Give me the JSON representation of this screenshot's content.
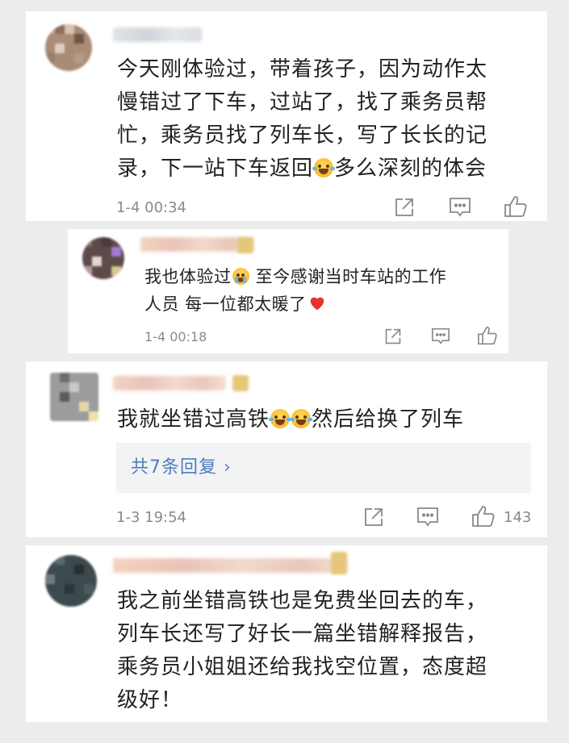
{
  "comments": [
    {
      "text_lines": [
        "今天刚体验过，带着孩子，因为动作太",
        "慢错过了下车，过站了，找了乘务员帮",
        "忙，乘务员找了列车长，写了长长的记"
      ],
      "last_line_before": "录，下一站下车返回",
      "last_line_after": "多么深刻的体会",
      "time": "1-4 00:34"
    },
    {
      "line1_before": "我也体验过",
      "line1_after": " 至今感谢当时车站的工作",
      "line2": "人员 每一位都太暖了",
      "time": "1-4 00:18"
    },
    {
      "before": "我就坐错过高铁",
      "after": "然后给换了列车",
      "replies_label": "共7条回复 ›",
      "time": "1-3 19:54",
      "likes": "143"
    },
    {
      "text_lines": [
        "我之前坐错高铁也是免费坐回去的车，",
        "列车长还写了好长一篇坐错解释报告，",
        "乘务员小姐姐还给我找空位置，态度超",
        "级好！"
      ]
    }
  ],
  "icons": [
    "share-icon",
    "comment-icon",
    "like-icon",
    "laugh-cry-emoji",
    "crying-emoji",
    "red-heart-emoji"
  ],
  "colors": {
    "background": "#ececec",
    "card": "#ffffff",
    "reply_link": "#4f7ebd",
    "meta_gray": "#8a8a8a"
  }
}
